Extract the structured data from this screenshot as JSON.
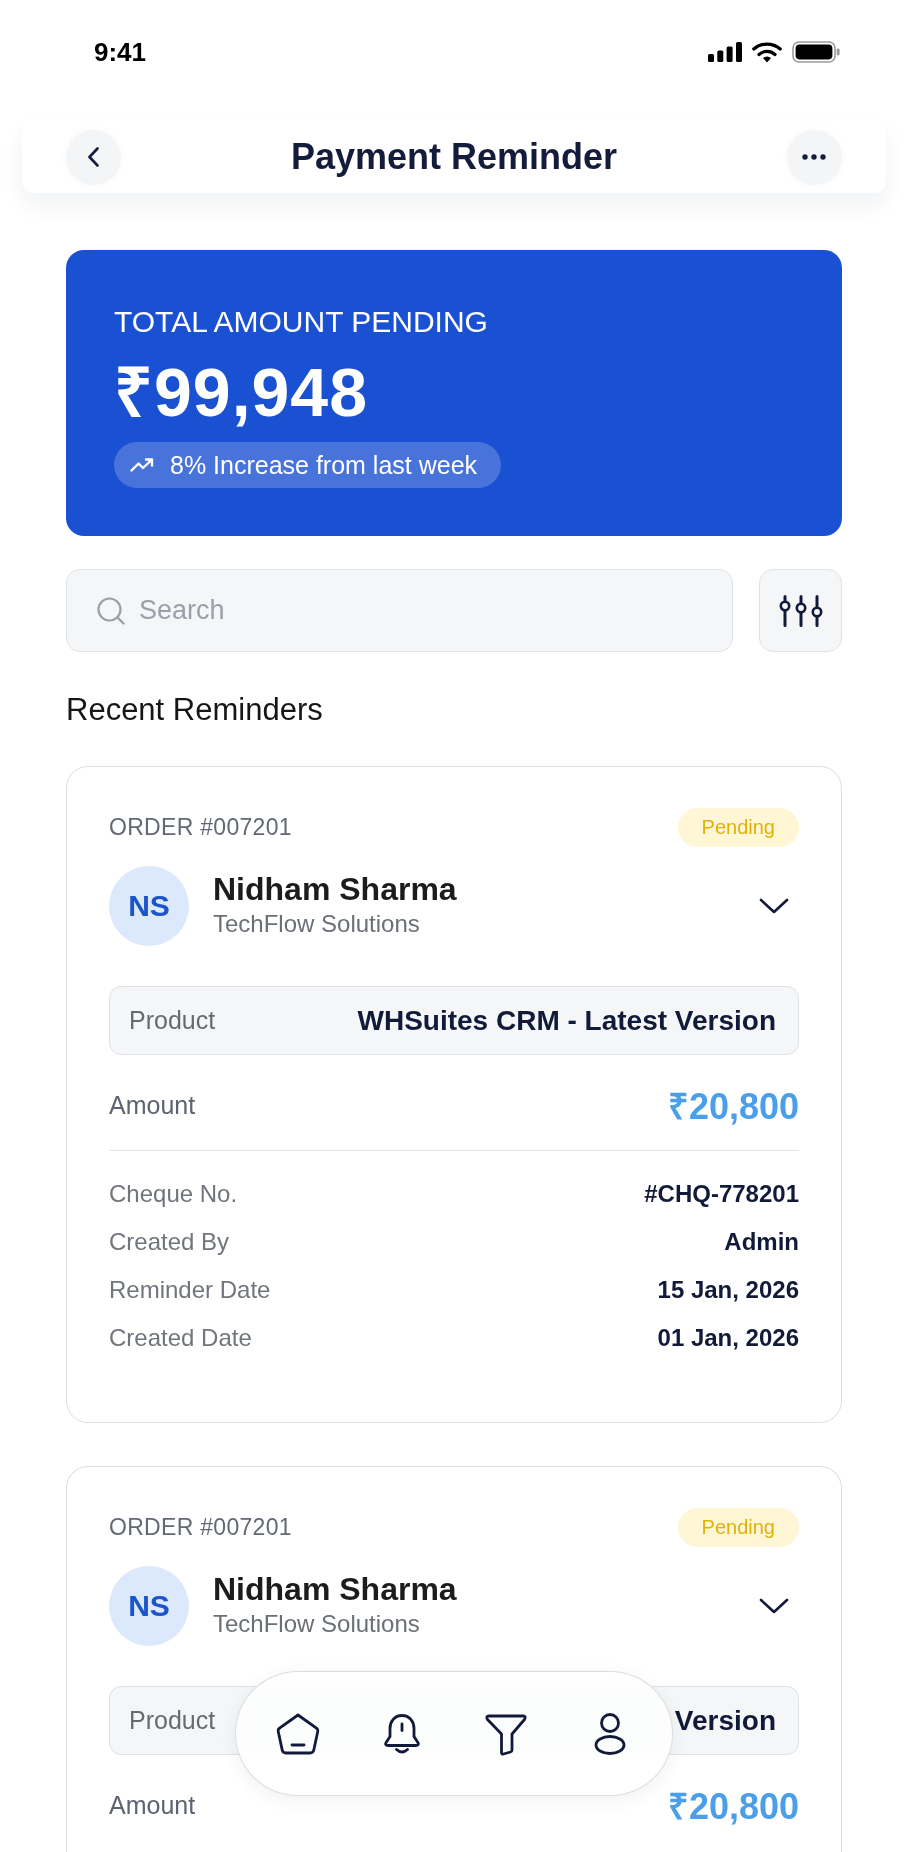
{
  "status_bar": {
    "time": "9:41"
  },
  "header": {
    "title": "Payment Reminder"
  },
  "summary": {
    "label": "TOTAL AMOUNT PENDING",
    "amount": "₹99,948",
    "trend": "8% Increase from last week"
  },
  "search": {
    "placeholder": "Search"
  },
  "reminders_section": {
    "title": "Recent Reminders",
    "items": [
      {
        "order": "ORDER #007201",
        "status": "Pending",
        "initials": "NS",
        "name": "Nidham Sharma",
        "company": "TechFlow Solutions",
        "product_label": "Product",
        "product": "WHSuites CRM - Latest Version",
        "amount_label": "Amount",
        "amount": "₹20,800",
        "details": [
          {
            "label": "Cheque No.",
            "value": "#CHQ-778201"
          },
          {
            "label": "Created By",
            "value": "Admin"
          },
          {
            "label": "Reminder Date",
            "value": "15 Jan, 2026"
          },
          {
            "label": "Created Date",
            "value": "01 Jan, 2026"
          }
        ]
      },
      {
        "order": "ORDER #007201",
        "status": "Pending",
        "initials": "NS",
        "name": "Nidham Sharma",
        "company": "TechFlow Solutions",
        "product_label": "Product",
        "product": "Version",
        "amount_label": "Amount",
        "amount": "₹20,800"
      }
    ]
  }
}
